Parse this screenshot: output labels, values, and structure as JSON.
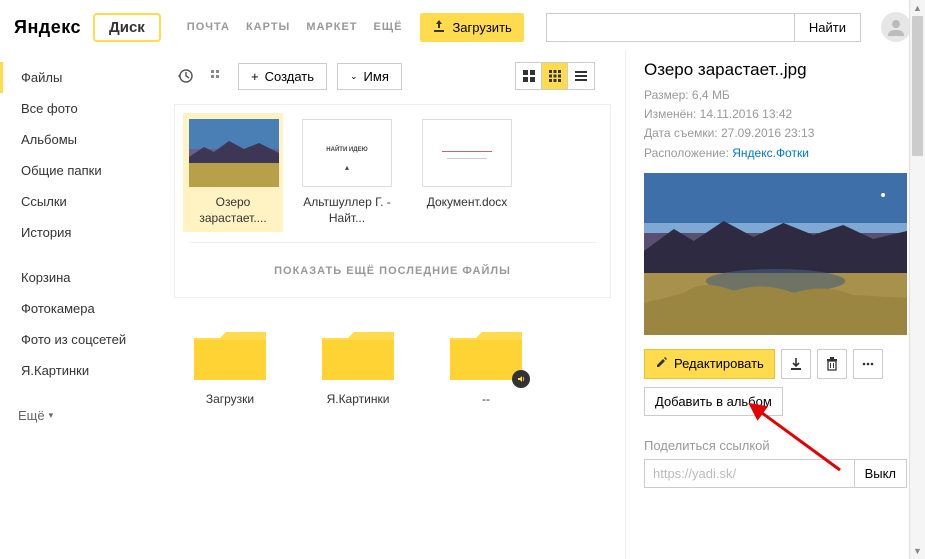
{
  "header": {
    "logo": "Яндекс",
    "disk": "Диск",
    "nav": {
      "mail": "ПОЧТА",
      "maps": "КАРТЫ",
      "market": "МАРКЕТ",
      "more": "ЕЩЁ"
    },
    "upload": "Загрузить",
    "search_placeholder": "",
    "find": "Найти"
  },
  "sidebar": {
    "items": [
      {
        "label": "Файлы",
        "active": true
      },
      {
        "label": "Все фото"
      },
      {
        "label": "Альбомы"
      },
      {
        "label": "Общие папки"
      },
      {
        "label": "Ссылки"
      },
      {
        "label": "История"
      }
    ],
    "secondary": [
      {
        "label": "Корзина"
      },
      {
        "label": "Фотокамера"
      },
      {
        "label": "Фото из соцсетей"
      },
      {
        "label": "Я.Картинки"
      }
    ],
    "more": "Ещё"
  },
  "toolbar": {
    "create": "Создать",
    "sort": "Имя"
  },
  "files": [
    {
      "name": "Озеро зарастает....",
      "type": "photo",
      "selected": true
    },
    {
      "name": "Альтшуллер Г. - Найт...",
      "type": "doc",
      "doc_text": "НАЙТИ ИДЕЮ"
    },
    {
      "name": "Документ.docx",
      "type": "doc",
      "doc_text": ""
    }
  ],
  "show_more": "ПОКАЗАТЬ ЕЩЁ ПОСЛЕДНИЕ ФАЙЛЫ",
  "folders": [
    {
      "name": "Загрузки"
    },
    {
      "name": "Я.Картинки"
    },
    {
      "name": "--",
      "badge": true
    }
  ],
  "panel": {
    "title": "Озеро зарастает..jpg",
    "meta": {
      "size_label": "Размер:",
      "size": "6,4 МБ",
      "changed_label": "Изменён:",
      "changed": "14.11.2016 13:42",
      "shot_label": "Дата съемки:",
      "shot": "27.09.2016 23:13",
      "location_label": "Расположение:",
      "location": "Яндекс.Фотки"
    },
    "edit": "Редактировать",
    "album": "Добавить в альбом",
    "share_label": "Поделиться ссылкой",
    "share_url": "https://yadi.sk/",
    "share_toggle": "Выкл"
  }
}
